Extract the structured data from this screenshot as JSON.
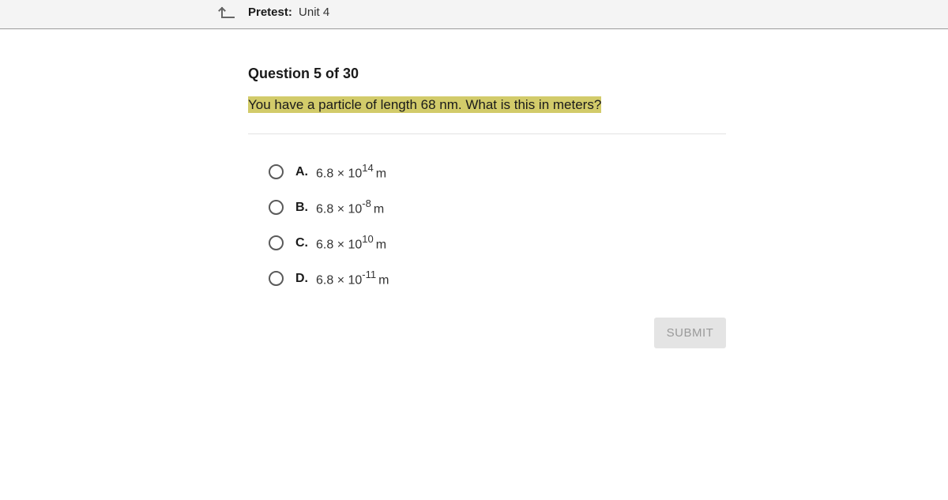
{
  "header": {
    "title_label": "Pretest:",
    "title_value": "Unit 4"
  },
  "question": {
    "number_text": "Question 5 of 30",
    "prompt": "You have a particle of length 68 nm. What is this in meters?"
  },
  "options": [
    {
      "letter": "A.",
      "base": "6.8 × 10",
      "exponent": "14",
      "unit": "m"
    },
    {
      "letter": "B.",
      "base": "6.8 × 10",
      "exponent": "-8",
      "unit": "m"
    },
    {
      "letter": "C.",
      "base": "6.8 × 10",
      "exponent": "10",
      "unit": "m"
    },
    {
      "letter": "D.",
      "base": "6.8 × 10",
      "exponent": "-11",
      "unit": "m"
    }
  ],
  "submit": {
    "label": "SUBMIT"
  },
  "colors": {
    "highlight": "#d2cb6a",
    "topbar": "#f4f4f4",
    "submit_bg": "#e4e4e4",
    "submit_text": "#9a9a9a"
  }
}
